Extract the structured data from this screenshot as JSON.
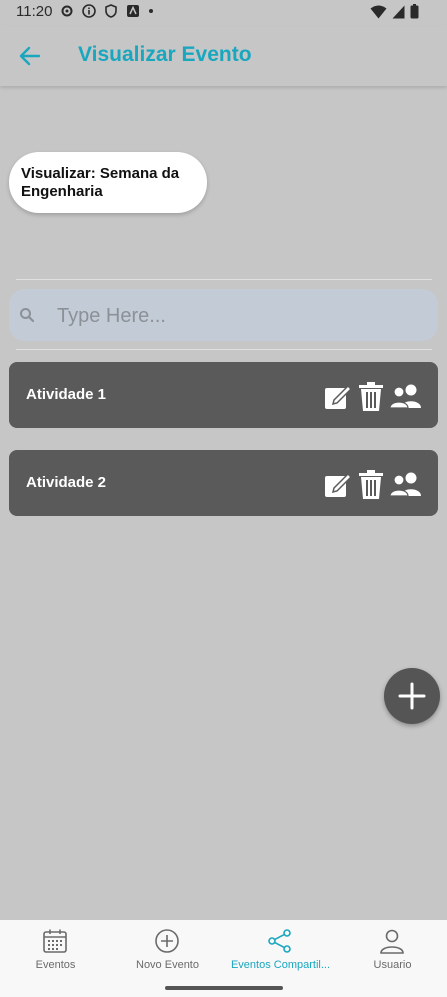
{
  "status_bar": {
    "time": "11:20"
  },
  "app_bar": {
    "title": "Visualizar Evento"
  },
  "event_chip": {
    "label": "Visualizar: Semana da Engenharia"
  },
  "search": {
    "placeholder": "Type Here...",
    "value": ""
  },
  "activities": [
    {
      "label": "Atividade 1"
    },
    {
      "label": "Atividade 2"
    }
  ],
  "bottom_nav": {
    "items": [
      {
        "label": "Eventos",
        "icon": "calendar-icon"
      },
      {
        "label": "Novo Evento",
        "icon": "add-circle-icon"
      },
      {
        "label": "Eventos Compartil...",
        "icon": "share-icon"
      },
      {
        "label": "Usuario",
        "icon": "user-icon"
      }
    ],
    "active_index": 2
  },
  "colors": {
    "accent": "#19a7bf",
    "background": "#c6c6c6",
    "card": "#5a5a5a"
  }
}
